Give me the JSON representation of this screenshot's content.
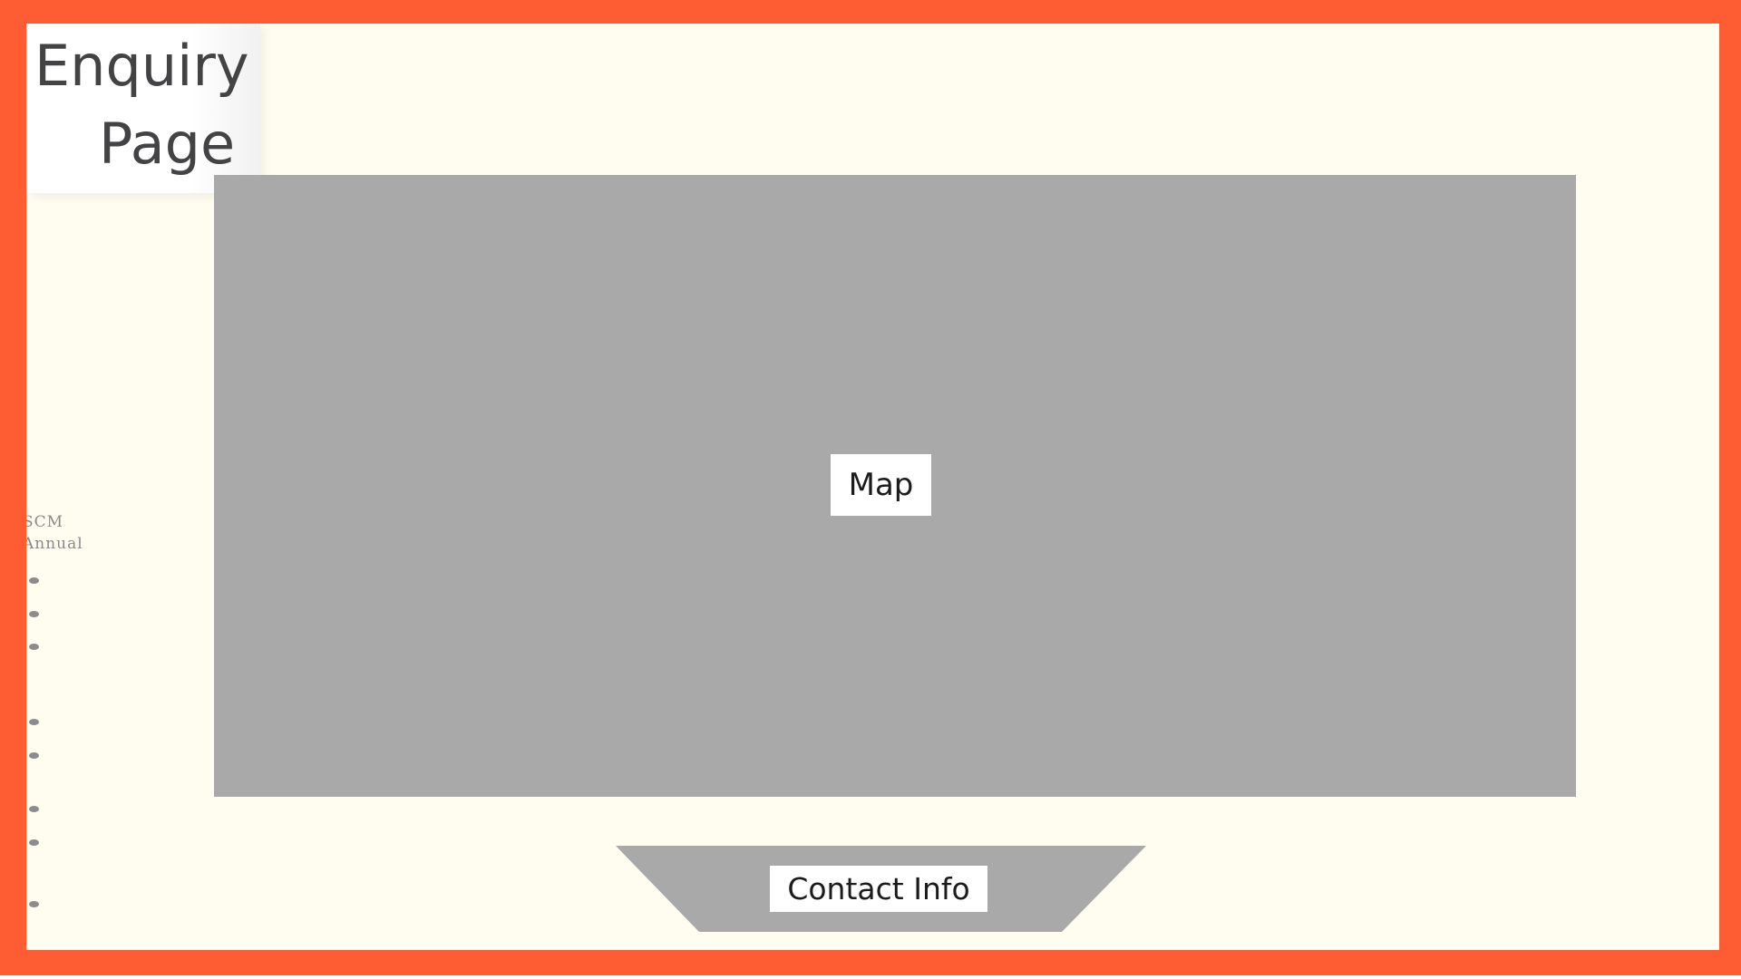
{
  "page": {
    "title_line_1": "Enquiry",
    "title_line_2": "Page"
  },
  "map": {
    "label": "Map"
  },
  "sidebar": {
    "text_1": "SCM",
    "text_2": "Annual",
    "bullet_count": 8
  },
  "contact": {
    "label": "Contact Info"
  },
  "colors": {
    "frame": "#fe5d33",
    "canvas": "#fffcf0",
    "placeholder": "#a9a9a9",
    "label_bg": "#ffffff",
    "title_text": "#434346"
  }
}
